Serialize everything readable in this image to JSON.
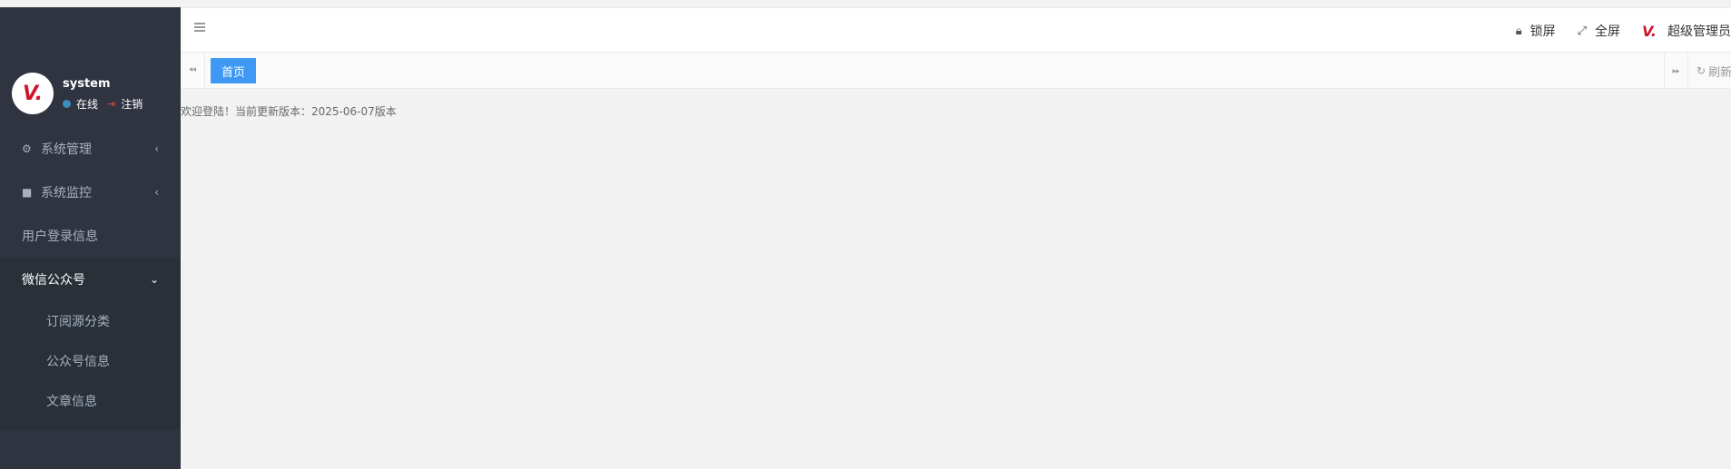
{
  "user": {
    "avatar_text": "V.",
    "name": "system",
    "status": "在线",
    "logout": "注销"
  },
  "menu": {
    "items": [
      {
        "label": "系统管理",
        "icon": "gear-icon"
      },
      {
        "label": "系统监控",
        "icon": "video-camera-icon"
      },
      {
        "label": "用户登录信息"
      },
      {
        "label": "微信公众号"
      }
    ],
    "submenu": [
      {
        "label": "订阅源分类"
      },
      {
        "label": "公众号信息"
      },
      {
        "label": "文章信息"
      }
    ]
  },
  "header": {
    "lock": "锁屏",
    "fullscreen": "全屏",
    "brand_mark": "V.",
    "admin": "超级管理员"
  },
  "tabs": {
    "home": "首页",
    "refresh": "刷新"
  },
  "content": {
    "welcome": "欢迎登陆！当前更新版本：2025-06-07版本"
  },
  "colors": {
    "sidebar_bg": "#2f3440",
    "active_tab": "#3f99f4",
    "brand_red": "#d0132a",
    "online_dot": "#3c8dbc"
  }
}
